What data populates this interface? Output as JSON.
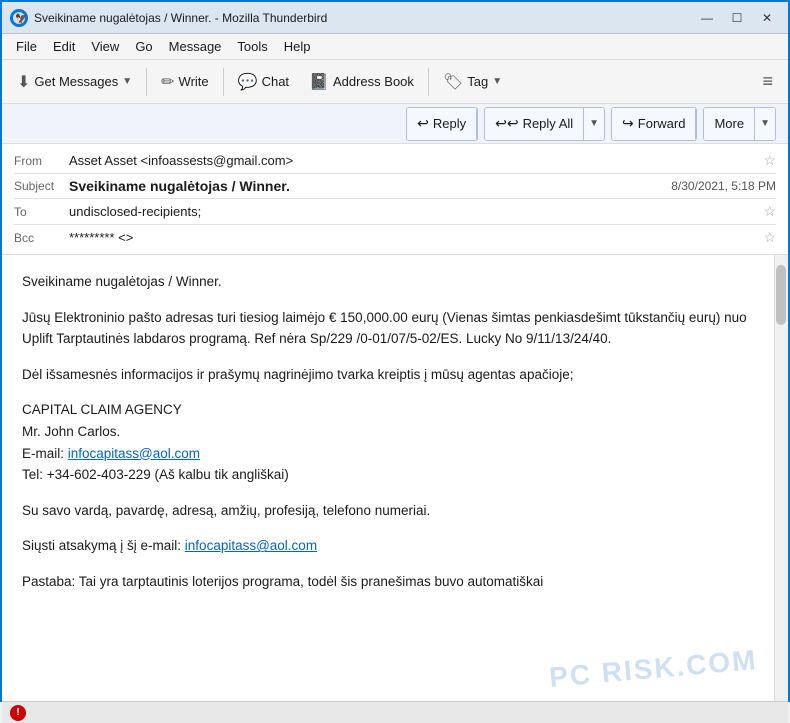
{
  "titlebar": {
    "title": "Sveikiname nugalėtojas / Winner. - Mozilla Thunderbird",
    "icon": "🦅",
    "controls": {
      "minimize": "—",
      "maximize": "☐",
      "close": "✕"
    }
  },
  "menubar": {
    "items": [
      "File",
      "Edit",
      "View",
      "Go",
      "Message",
      "Tools",
      "Help"
    ]
  },
  "toolbar": {
    "get_messages_label": "Get Messages",
    "write_label": "Write",
    "chat_label": "Chat",
    "address_book_label": "Address Book",
    "tag_label": "Tag",
    "hamburger": "≡"
  },
  "action_toolbar": {
    "reply_label": "Reply",
    "reply_all_label": "Reply All",
    "forward_label": "Forward",
    "more_label": "More"
  },
  "email": {
    "from_label": "From",
    "from_name": "Asset Asset <infoassests@gmail.com>",
    "subject_label": "Subject",
    "subject": "Sveikiname nugalėtojas / Winner.",
    "date": "8/30/2021, 5:18 PM",
    "to_label": "To",
    "to_value": "undisclosed-recipients;",
    "bcc_label": "Bcc",
    "bcc_value": "********* <>"
  },
  "body": {
    "greeting": "Sveikiname nugalėtojas / Winner.",
    "paragraph1": "Jūsų Elektroninio pašto adresas turi tiesiog laimėjo € 150,000.00 eurų (Vienas šimtas penkiasdešimt tūkstančių eurų) nuo Uplift Tarptautinės labdaros programą. Ref nėra Sp/229 /0-01/07/5-02/ES. Lucky No 9/11/13/24/40.",
    "paragraph2": "Dėl išsamesnės informacijos ir prašymų nagrinėjimo tvarka kreiptis į mūsų agentas apačioje;",
    "agency_name": "CAPITAL CLAIM AGENCY",
    "agent_name": "Mr. John Carlos.",
    "email_label": "E-mail: ",
    "email_address": "infocapitass@aol.com",
    "tel_value": "Tel: +34-602-403-229 (Aš kalbu tik angliškai)",
    "paragraph3": "Su savo vardą, pavardę, adresą, amžių, profesiją, telefono numeriai.",
    "send_label": "Siųsti atsakymą į šį e-mail: ",
    "send_email": "infocapitass@aol.com",
    "paragraph4": "Pastaba: Tai yra tarptautinis loterijos programa, todėl šis pranešimas buvo automatiškai"
  },
  "statusbar": {
    "icon_label": "!",
    "text": ""
  },
  "watermark": "PC RISK.COM"
}
